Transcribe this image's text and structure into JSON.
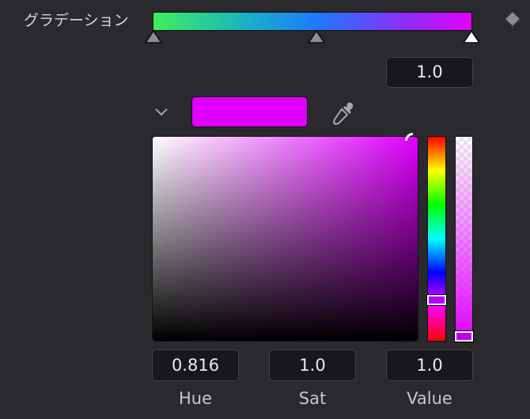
{
  "gradient": {
    "label": "グラデーション",
    "position_value": "1.0",
    "stop_positions": [
      0.0,
      0.5,
      1.0
    ],
    "colors": {
      "start": "#3ef05a",
      "end": "#e200ff"
    }
  },
  "color_picker": {
    "swatch_color": "#e000ff",
    "hue": {
      "value": "0.816",
      "label": "Hue",
      "level": 0.816
    },
    "sat": {
      "value": "1.0",
      "label": "Sat",
      "level": 1.0
    },
    "val": {
      "value": "1.0",
      "label": "Value",
      "level": 1.0
    }
  },
  "icons": {
    "collapse": "chevron-down-icon",
    "eyedropper": "eyedropper-icon",
    "keyframe": "keyframe-diamond-icon"
  }
}
